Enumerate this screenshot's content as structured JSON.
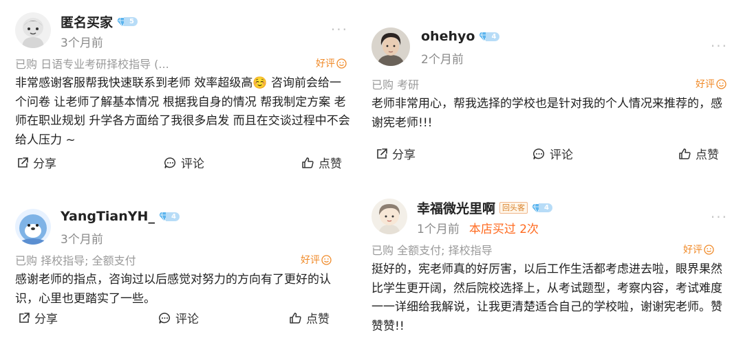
{
  "reviews": [
    {
      "username": "匿名买家",
      "level": "5",
      "time": "3个月前",
      "bought": "已购 日语专业考研择校指导 (...",
      "rating": "好评",
      "content": "非常感谢客服帮我快速联系到老师 效率超级高☺️ 咨询前会给一个问卷 让老师了解基本情况 根据我自身的情况 帮我制定方案 老师在职业规划 升学各方面给了我很多启发  而且在交谈过程中不会给人压力 ~",
      "share": "分享",
      "comment": "评论",
      "like": "点赞"
    },
    {
      "username": "ohehyo",
      "level": "4",
      "time": "2个月前",
      "bought": "已购 考研",
      "rating": "好评",
      "content": "老师非常用心，帮我选择的学校也是针对我的个人情况来推荐的，感谢宪老师!!!",
      "share": "分享",
      "comment": "评论",
      "like": "点赞"
    },
    {
      "username": "YangTianYH_",
      "level": "4",
      "time": "3个月前",
      "bought": "已购 择校指导; 全额支付",
      "rating": "好评",
      "content": "感谢老师的指点，咨询过以后感觉对努力的方向有了更好的认识，心里也更踏实了一些。",
      "share": "分享",
      "comment": "评论",
      "like": "点赞"
    },
    {
      "username": "幸福微光里啊",
      "tag": "回头客",
      "level": "4",
      "time": "1个月前",
      "repeat": "本店买过 2次",
      "bought": "已购 全额支付; 择校指导",
      "rating": "好评",
      "content": "挺好的，宪老师真的好厉害，以后工作生活都考虑进去啦，眼界果然比学生更开阔，然后院校选择上，从考试题型，考察内容，考试难度一一详细给我解说，让我更清楚适合自己的学校啦，谢谢宪老师。赞赞赞!!",
      "share": "分享",
      "comment": "评论",
      "like": "点赞"
    }
  ],
  "colors": {
    "accent": "#ff6a1f",
    "rating": "#f08a28",
    "muted": "#9a9a9a",
    "diamond": "#5ab4ee"
  },
  "icons": [
    "share-icon",
    "comment-icon",
    "like-icon",
    "diamond-icon",
    "smile-icon",
    "more-icon"
  ]
}
